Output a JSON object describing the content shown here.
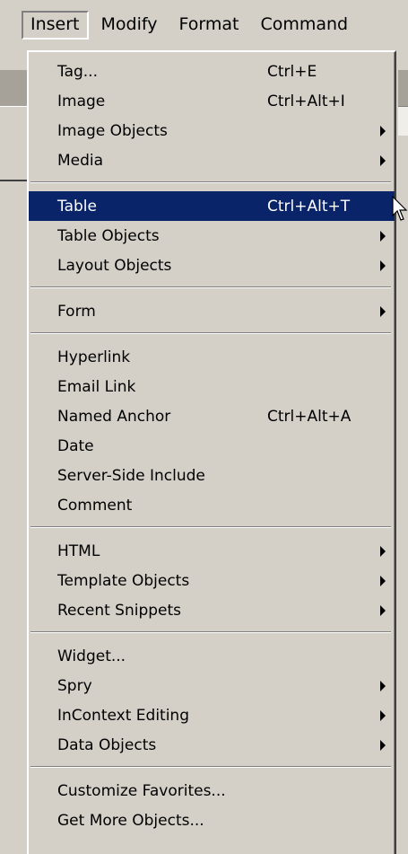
{
  "menubar": {
    "items": [
      {
        "label": "Insert",
        "active": true
      },
      {
        "label": "Modify",
        "active": false
      },
      {
        "label": "Format",
        "active": false
      },
      {
        "label": "Command",
        "active": false
      }
    ]
  },
  "menu": {
    "groups": [
      [
        {
          "label": "Tag...",
          "shortcut": "Ctrl+E",
          "submenu": false
        },
        {
          "label": "Image",
          "shortcut": "Ctrl+Alt+I",
          "submenu": false
        },
        {
          "label": "Image Objects",
          "shortcut": "",
          "submenu": true
        },
        {
          "label": "Media",
          "shortcut": "",
          "submenu": true
        }
      ],
      [
        {
          "label": "Table",
          "shortcut": "Ctrl+Alt+T",
          "submenu": false,
          "highlighted": true
        },
        {
          "label": "Table Objects",
          "shortcut": "",
          "submenu": true
        },
        {
          "label": "Layout Objects",
          "shortcut": "",
          "submenu": true
        }
      ],
      [
        {
          "label": "Form",
          "shortcut": "",
          "submenu": true
        }
      ],
      [
        {
          "label": "Hyperlink",
          "shortcut": "",
          "submenu": false
        },
        {
          "label": "Email Link",
          "shortcut": "",
          "submenu": false
        },
        {
          "label": "Named Anchor",
          "shortcut": "Ctrl+Alt+A",
          "submenu": false
        },
        {
          "label": "Date",
          "shortcut": "",
          "submenu": false
        },
        {
          "label": "Server-Side Include",
          "shortcut": "",
          "submenu": false
        },
        {
          "label": "Comment",
          "shortcut": "",
          "submenu": false
        }
      ],
      [
        {
          "label": "HTML",
          "shortcut": "",
          "submenu": true
        },
        {
          "label": "Template Objects",
          "shortcut": "",
          "submenu": true
        },
        {
          "label": "Recent Snippets",
          "shortcut": "",
          "submenu": true
        }
      ],
      [
        {
          "label": "Widget...",
          "shortcut": "",
          "submenu": false
        },
        {
          "label": "Spry",
          "shortcut": "",
          "submenu": true
        },
        {
          "label": "InContext Editing",
          "shortcut": "",
          "submenu": true
        },
        {
          "label": "Data Objects",
          "shortcut": "",
          "submenu": true
        }
      ],
      [
        {
          "label": "Customize Favorites...",
          "shortcut": "",
          "submenu": false
        },
        {
          "label": "Get More Objects...",
          "shortcut": "",
          "submenu": false
        }
      ]
    ]
  },
  "colors": {
    "menu_bg": "#d4d0c8",
    "highlight_bg": "#0a246a",
    "highlight_text": "#ffffff"
  },
  "icons": {
    "submenu": "triangle-right-icon",
    "cursor": "mouse-pointer-icon"
  }
}
